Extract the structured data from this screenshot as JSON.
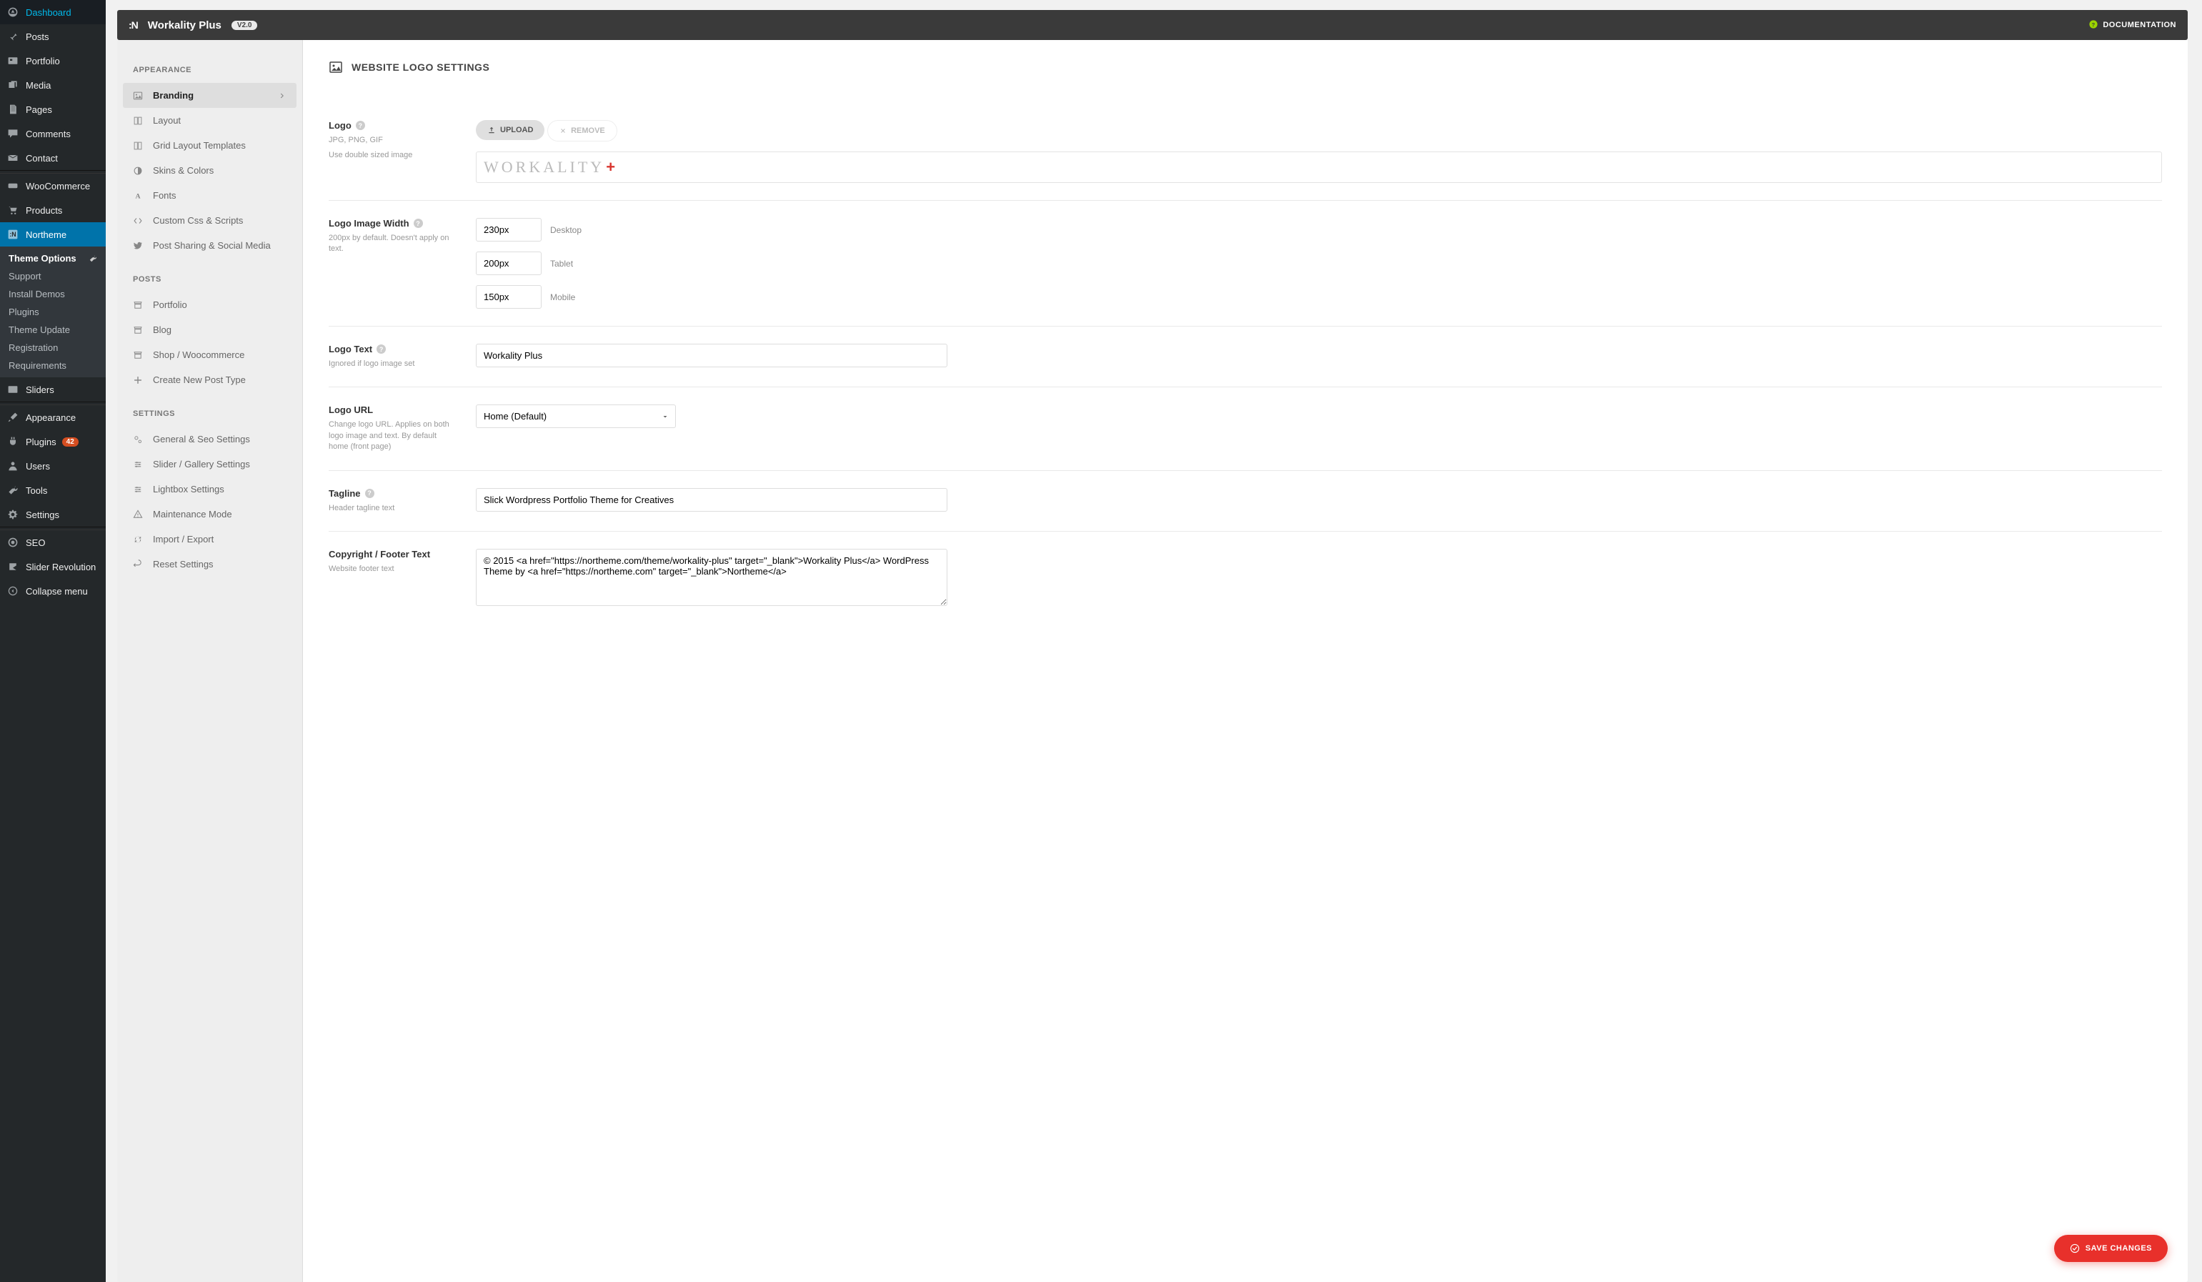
{
  "wp_menu": [
    {
      "label": "Dashboard",
      "icon": "gauge"
    },
    {
      "label": "Posts",
      "icon": "pin"
    },
    {
      "label": "Portfolio",
      "icon": "portfolio"
    },
    {
      "label": "Media",
      "icon": "media"
    },
    {
      "label": "Pages",
      "icon": "pages"
    },
    {
      "label": "Comments",
      "icon": "comment"
    },
    {
      "label": "Contact",
      "icon": "mail"
    }
  ],
  "wp_menu2": [
    {
      "label": "WooCommerce",
      "icon": "woo"
    },
    {
      "label": "Products",
      "icon": "cart"
    },
    {
      "label": "Northeme",
      "icon": "n",
      "active": true
    }
  ],
  "wp_submenu": [
    {
      "label": "Theme Options",
      "bold": true,
      "wrench": true
    },
    {
      "label": "Support"
    },
    {
      "label": "Install Demos"
    },
    {
      "label": "Plugins"
    },
    {
      "label": "Theme Update"
    },
    {
      "label": "Registration"
    },
    {
      "label": "Requirements"
    }
  ],
  "wp_menu3": [
    {
      "label": "Sliders",
      "icon": "sliders"
    }
  ],
  "wp_menu4": [
    {
      "label": "Appearance",
      "icon": "brush"
    },
    {
      "label": "Plugins",
      "icon": "plug",
      "badge": "42"
    },
    {
      "label": "Users",
      "icon": "user"
    },
    {
      "label": "Tools",
      "icon": "wrench"
    },
    {
      "label": "Settings",
      "icon": "gear"
    }
  ],
  "wp_menu5": [
    {
      "label": "SEO",
      "icon": "seo"
    },
    {
      "label": "Slider Revolution",
      "icon": "sr"
    },
    {
      "label": "Collapse menu",
      "icon": "collapse"
    }
  ],
  "topbar": {
    "logo": ":N",
    "title": "Workality Plus",
    "version": "V2.0",
    "doc_label": "DOCUMENTATION"
  },
  "theme_sidebar": {
    "groups": [
      {
        "title": "APPEARANCE",
        "items": [
          {
            "label": "Branding",
            "icon": "image",
            "active": true
          },
          {
            "label": "Layout",
            "icon": "layout"
          },
          {
            "label": "Grid Layout Templates",
            "icon": "layout"
          },
          {
            "label": "Skins & Colors",
            "icon": "contrast"
          },
          {
            "label": "Fonts",
            "icon": "font"
          },
          {
            "label": "Custom Css & Scripts",
            "icon": "code"
          },
          {
            "label": "Post Sharing & Social Media",
            "icon": "twitter"
          }
        ]
      },
      {
        "title": "POSTS",
        "items": [
          {
            "label": "Portfolio",
            "icon": "archive"
          },
          {
            "label": "Blog",
            "icon": "archive"
          },
          {
            "label": "Shop / Woocommerce",
            "icon": "archive"
          },
          {
            "label": "Create New Post Type",
            "icon": "plus"
          }
        ]
      },
      {
        "title": "SETTINGS",
        "items": [
          {
            "label": "General & Seo Settings",
            "icon": "cogs"
          },
          {
            "label": "Slider / Gallery Settings",
            "icon": "sliders2"
          },
          {
            "label": "Lightbox Settings",
            "icon": "sliders2"
          },
          {
            "label": "Maintenance Mode",
            "icon": "warn"
          },
          {
            "label": "Import / Export",
            "icon": "refresh"
          },
          {
            "label": "Reset Settings",
            "icon": "undo"
          }
        ]
      }
    ]
  },
  "settings": {
    "heading": "WEBSITE LOGO SETTINGS",
    "logo": {
      "label": "Logo",
      "help1": "JPG, PNG, GIF",
      "help2": "Use double sized image",
      "upload": "UPLOAD",
      "remove": "REMOVE",
      "preview_text": "WORKALITY",
      "preview_plus": "+"
    },
    "width": {
      "label": "Logo Image Width",
      "help": "200px by default. Doesn't apply on text.",
      "desktop": {
        "value": "230px",
        "label": "Desktop"
      },
      "tablet": {
        "value": "200px",
        "label": "Tablet"
      },
      "mobile": {
        "value": "150px",
        "label": "Mobile"
      }
    },
    "logo_text": {
      "label": "Logo Text",
      "help": "Ignored if logo image set",
      "value": "Workality Plus"
    },
    "logo_url": {
      "label": "Logo URL",
      "help": "Change logo URL. Applies on both logo image and text. By default home (front page)",
      "value": "Home (Default)"
    },
    "tagline": {
      "label": "Tagline",
      "help": "Header tagline text",
      "value": "Slick Wordpress Portfolio Theme for Creatives"
    },
    "copyright": {
      "label": "Copyright / Footer Text",
      "help": "Website footer text",
      "value": "© 2015 <a href=\"https://northeme.com/theme/workality-plus\" target=\"_blank\">Workality Plus</a> WordPress Theme by <a href=\"https://northeme.com\" target=\"_blank\">Northeme</a>"
    },
    "save": "SAVE CHANGES"
  }
}
